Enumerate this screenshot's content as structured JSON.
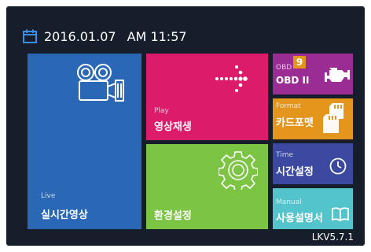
{
  "status": {
    "date": "2016.01.07",
    "time": "AM 11:57",
    "calendar_icon": "calendar-icon"
  },
  "tiles": {
    "live": {
      "caption": "Live",
      "label": "실시간영상",
      "icon": "film-camera-icon",
      "color": "#2a67b5"
    },
    "play": {
      "caption": "Play",
      "label": "영상재생",
      "icon": "dotted-arrow-icon",
      "color": "#dc1c6a"
    },
    "env": {
      "caption": "",
      "label": "환경설정",
      "icon": "gear-icon",
      "color": "#7cc444"
    },
    "obd": {
      "caption": "OBD",
      "badge": "9",
      "label": "OBD II",
      "icon": "engine-icon",
      "color": "#9b2c93"
    },
    "format": {
      "caption": "Format",
      "label": "카드포맷",
      "icon": "sd-card-icon",
      "color": "#e3961b"
    },
    "time": {
      "caption": "Time",
      "label": "시간설정",
      "icon": "clock-icon",
      "color": "#3b4aa0"
    },
    "manual": {
      "caption": "Manual",
      "label": "사용설명서",
      "icon": "book-icon",
      "color": "#53c4cc"
    }
  },
  "version": "LKV5.7.1"
}
